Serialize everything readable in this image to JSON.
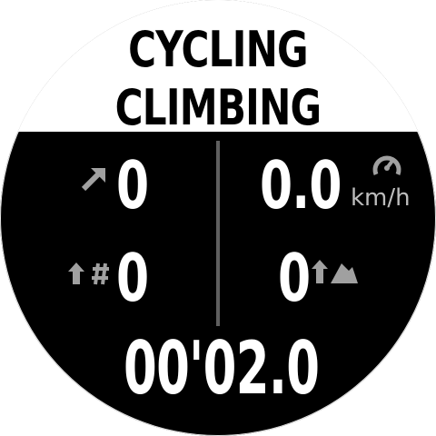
{
  "header": {
    "title_line1": "CYCLING",
    "title_line2": "CLIMBING"
  },
  "fields": {
    "ascent": {
      "value": "0",
      "icon": "ascent-arrow-icon"
    },
    "speed": {
      "value": "0.0",
      "unit": "km/h",
      "icon": "speedometer-icon"
    },
    "climb_laps": {
      "value": "0",
      "icon": "climb-count-icon"
    },
    "peaks": {
      "value": "0",
      "icon": "climb-peak-icon"
    },
    "duration": {
      "value": "00'02.0"
    }
  },
  "colors": {
    "background": "#000000",
    "header_background": "#ffffff",
    "value_text": "#ffffff",
    "icon_gray": "#a0a0a0",
    "divider": "#5f5f5f"
  }
}
